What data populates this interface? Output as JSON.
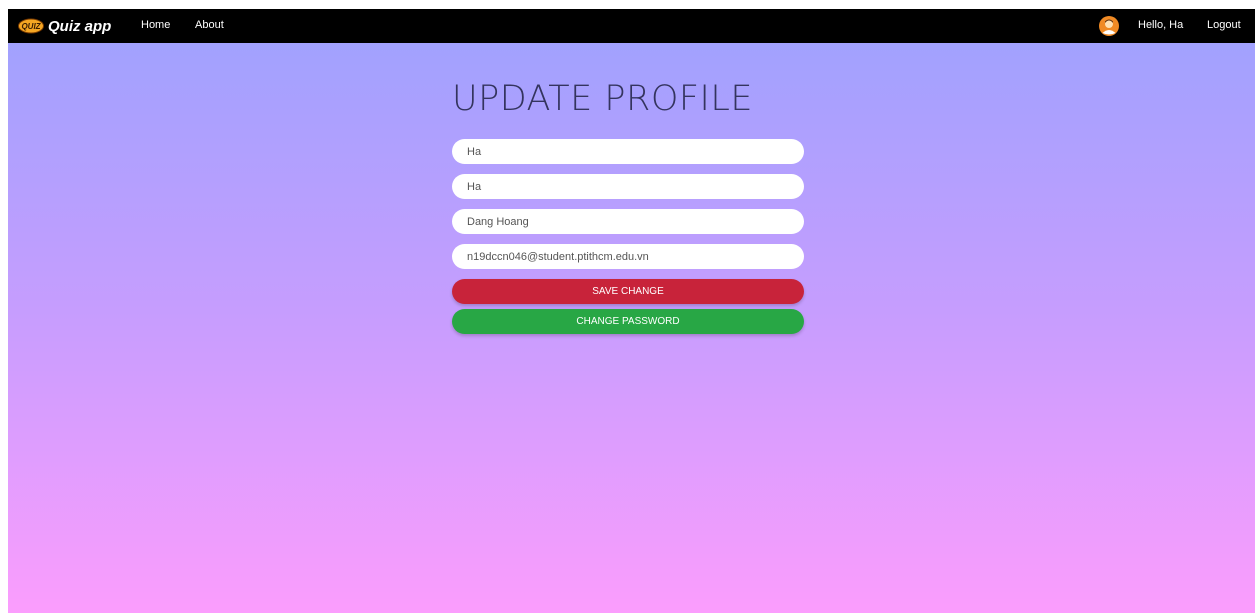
{
  "navbar": {
    "brand_logo_text": "QUIZ",
    "brand_name": "Quiz app",
    "links": [
      "Home",
      "About"
    ],
    "greeting": "Hello, Ha",
    "logout_label": "Logout"
  },
  "form": {
    "title": "UPDATE PROFILE",
    "fields": [
      {
        "name": "username",
        "value": "Ha"
      },
      {
        "name": "first-name",
        "value": "Ha"
      },
      {
        "name": "last-name",
        "value": "Dang Hoang"
      },
      {
        "name": "email",
        "value": "n19dccn046@student.ptithcm.edu.vn"
      }
    ],
    "save_label": "SAVE CHANGE",
    "change_password_label": "CHANGE PASSWORD"
  },
  "colors": {
    "navbar_bg": "#000000",
    "gradient_top": "#9da2fe",
    "gradient_bottom": "#fb9dfd",
    "save_button": "#c8233a",
    "change_password_button": "#28a745"
  },
  "icons": {
    "brand": "quiz-logo-icon",
    "user": "avatar-icon"
  }
}
